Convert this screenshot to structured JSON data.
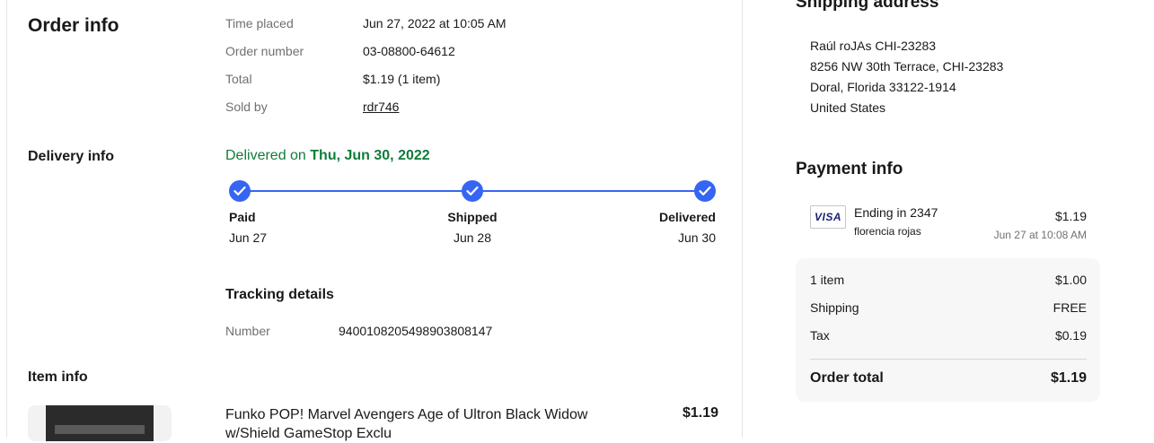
{
  "order": {
    "heading": "Order info",
    "time_placed_label": "Time placed",
    "time_placed_value": "Jun 27, 2022 at 10:05 AM",
    "order_number_label": "Order number",
    "order_number_value": "03-08800-64612",
    "total_label": "Total",
    "total_value": "$1.19 (1 item)",
    "sold_by_label": "Sold by",
    "sold_by_value": "rdr746"
  },
  "delivery": {
    "heading": "Delivery info",
    "status_prefix": "Delivered on ",
    "status_date": "Thu, Jun 30, 2022",
    "steps": [
      {
        "name": "Paid",
        "date": "Jun 27"
      },
      {
        "name": "Shipped",
        "date": "Jun 28"
      },
      {
        "name": "Delivered",
        "date": "Jun 30"
      }
    ],
    "tracking_heading": "Tracking details",
    "tracking_label": "Number",
    "tracking_value": "9400108205498903808147"
  },
  "item": {
    "heading": "Item info",
    "title": "Funko POP! Marvel Avengers Age of Ultron Black Widow w/Shield GameStop Exclu",
    "price": "$1.19"
  },
  "shipping": {
    "heading": "Shipping address",
    "lines": [
      "Raúl roJAs CHI-23283",
      "8256 NW 30th Terrace, CHI-23283",
      "Doral, Florida 33122-1914",
      "United States"
    ]
  },
  "payment": {
    "heading": "Payment info",
    "card_brand": "VISA",
    "card_ending": "Ending in 2347",
    "card_holder": "florencia rojas",
    "amount": "$1.19",
    "date": "Jun 27 at 10:08 AM",
    "summary": {
      "items_label": "1 item",
      "items_value": "$1.00",
      "shipping_label": "Shipping",
      "shipping_value": "FREE",
      "tax_label": "Tax",
      "tax_value": "$0.19",
      "total_label": "Order total",
      "total_value": "$1.19"
    }
  },
  "colors": {
    "accent_blue": "#3665f3",
    "delivered_green": "#107c3b"
  },
  "icons": {
    "step_check": "check-circle-icon",
    "card": "visa-card-icon"
  }
}
